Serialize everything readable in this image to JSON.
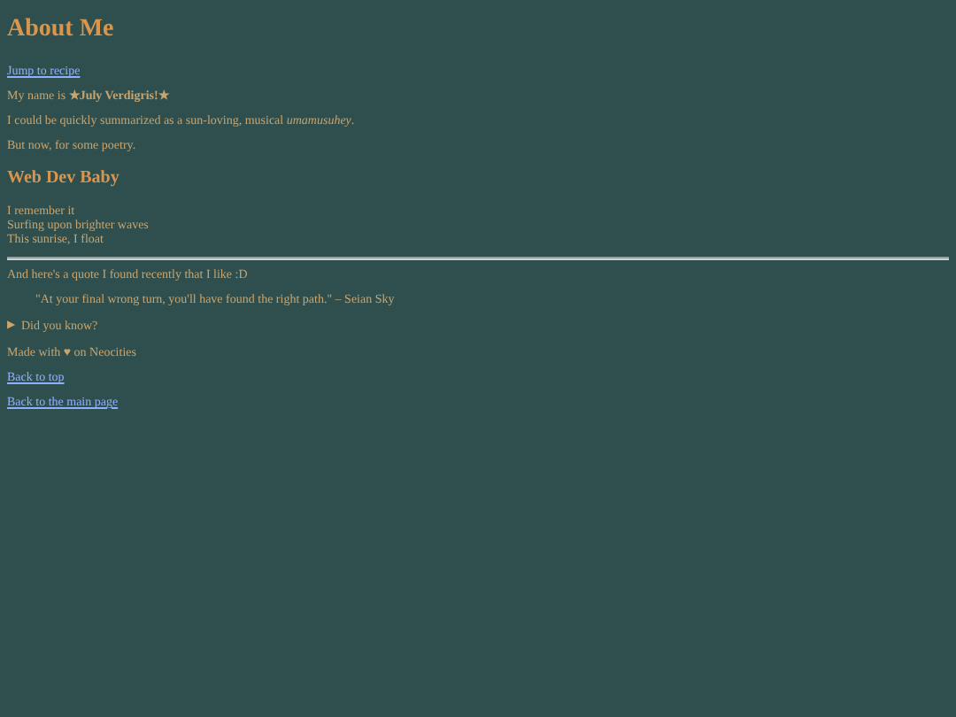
{
  "title": "About Me",
  "jump_link": "Jump to recipe",
  "name_line": "My name is **★July Verdigris!★**",
  "summary": "I could be quickly summarized as a sun-loving, musical *umamusuhey*.",
  "poetry_intro": "But now, for some poetry.",
  "poem": {
    "title": "Web Dev Baby",
    "lines": [
      "I remember it",
      "Surfing upon brighter waves",
      "This sunrise, I float"
    ]
  },
  "quote_intro": "And here's a quote I found recently that I like :D",
  "quote": "\"At your final wrong turn, you'll have found the right path.\" – Seian Sky",
  "details": {
    "marker": "▶",
    "summary": "Did you know?",
    "expanded": false
  },
  "footer": "Made with ♥ on Neocities",
  "links": [
    "Back to top",
    "Back to the main page"
  ]
}
